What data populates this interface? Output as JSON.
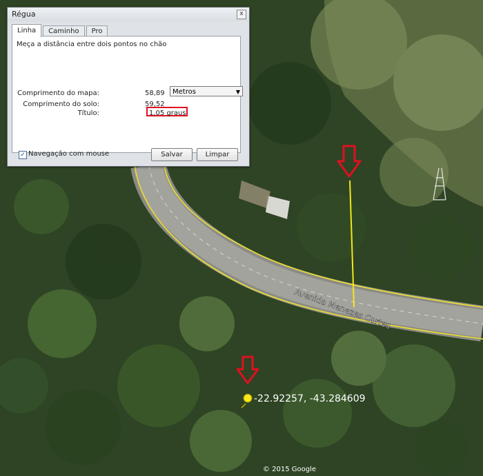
{
  "dialog": {
    "title": "Régua",
    "close_label": "x",
    "tabs": [
      "Linha",
      "Caminho",
      "Pro"
    ],
    "description": "Meça a distância entre dois pontos no chão",
    "map_length_label": "Comprimento do mapa:",
    "map_length_value": "58,89",
    "unit_selected": "Metros",
    "ground_length_label": "Comprimento do solo:",
    "ground_length_value": "59,52",
    "heading_label": "Título:",
    "heading_value": "1,05 graus",
    "mouse_nav_label": "Navegação com mouse",
    "mouse_nav_checked": true,
    "save_label": "Salvar",
    "clear_label": "Limpar"
  },
  "map": {
    "road_label": "Avenida Menezes Cortes",
    "coordinates": "-22.92257, -43.284609",
    "copyright": "© 2015 Google",
    "ruler_color": "#f5e61a",
    "marker_arrow_color": "#e01020"
  }
}
